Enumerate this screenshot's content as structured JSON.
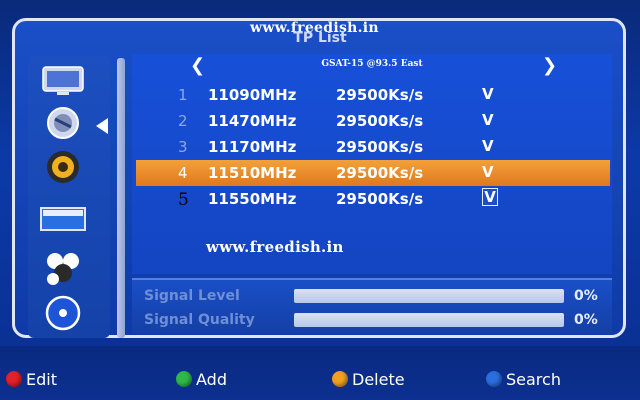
{
  "watermark_top": "www.freedish.in",
  "watermark_mid": "www.freedish.in",
  "title": "TP List",
  "satellite": {
    "name": "GSAT-15 @93.5 East",
    "prev_icon": "chevron-left-icon",
    "next_icon": "chevron-right-icon"
  },
  "sidebar": {
    "items": [
      {
        "icon": "tv-icon"
      },
      {
        "icon": "satellite-dish-icon"
      },
      {
        "icon": "settings-gear-icon"
      },
      {
        "icon": "media-box-icon"
      },
      {
        "icon": "games-icon"
      },
      {
        "icon": "disc-icon"
      }
    ],
    "active_index": 1
  },
  "transponders": [
    {
      "index": "1",
      "frequency": "11090MHz",
      "symbol_rate": "29500Ks/s",
      "check": "V",
      "selected": false
    },
    {
      "index": "2",
      "frequency": "11470MHz",
      "symbol_rate": "29500Ks/s",
      "check": "V",
      "selected": false
    },
    {
      "index": "3",
      "frequency": "11170MHz",
      "symbol_rate": "29500Ks/s",
      "check": "V",
      "selected": false
    },
    {
      "index": "4",
      "frequency": "11510MHz",
      "symbol_rate": "29500Ks/s",
      "check": "V",
      "selected": true
    },
    {
      "index": "5",
      "frequency": "11550MHz",
      "symbol_rate": "29500Ks/s",
      "check": "V",
      "selected": false
    }
  ],
  "signal": {
    "level_label": "Signal Level",
    "level_value": "0%",
    "level_fraction": 0,
    "quality_label": "Signal Quality",
    "quality_value": "0%",
    "quality_fraction": 0
  },
  "buttons": {
    "edit": {
      "label": "Edit",
      "color": "#e0202a"
    },
    "add": {
      "label": "Add",
      "color": "#2fb84a"
    },
    "delete": {
      "label": "Delete",
      "color": "#f0a020"
    },
    "search": {
      "label": "Search",
      "color": "#2a6ee0"
    }
  },
  "colors": {
    "highlight": "#ee8a28",
    "background": "#0b3aa8"
  }
}
